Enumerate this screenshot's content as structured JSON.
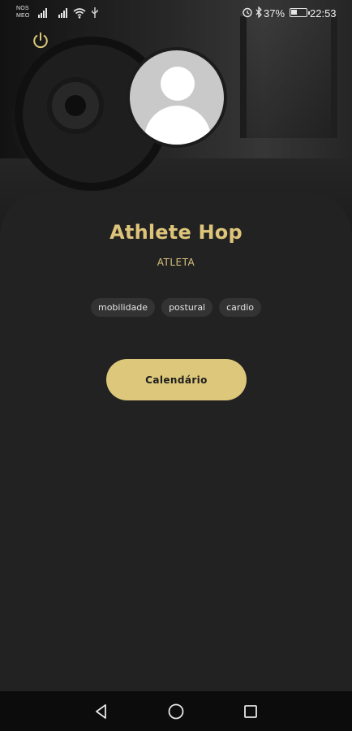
{
  "status_bar": {
    "carrier_top": "NOS",
    "carrier_bottom": "MEO",
    "battery": "37%",
    "time": "22:53"
  },
  "profile": {
    "name": "Athlete Hop",
    "role": "ATLETA",
    "tags": [
      "mobilidade",
      "postural",
      "cardio"
    ]
  },
  "actions": {
    "calendar_label": "Calendário"
  },
  "icons": {
    "power": "power-icon",
    "avatar": "user-placeholder-icon",
    "nav_back": "triangle-back-icon",
    "nav_home": "circle-home-icon",
    "nav_recent": "square-recent-icon"
  },
  "colors": {
    "accent": "#dcc77a",
    "background": "#222222",
    "tag_bg": "#333333",
    "navbar": "#0c0c0c"
  }
}
